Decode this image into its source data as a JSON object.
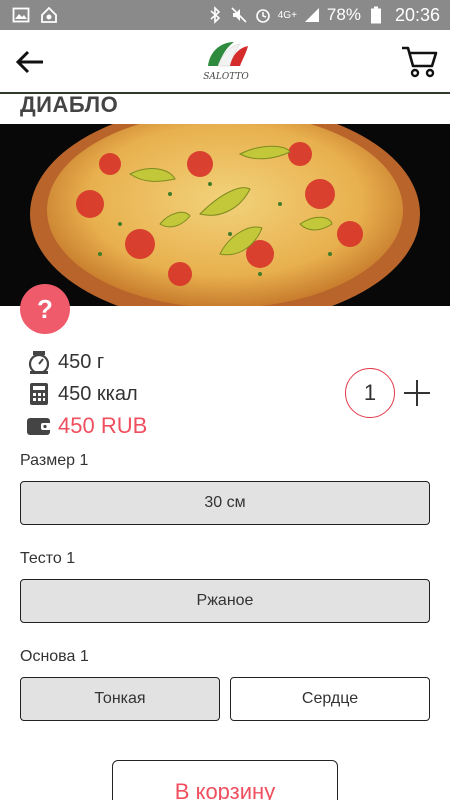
{
  "status_bar": {
    "network": "4G+",
    "battery": "78%",
    "time": "20:36"
  },
  "app": {
    "logo_text": "SALOTTO"
  },
  "product": {
    "title": "ДИАБЛО",
    "help_label": "?",
    "weight": "450 г",
    "calories": "450 ккал",
    "price": "450 RUB",
    "quantity": "1"
  },
  "options": {
    "size": {
      "label": "Размер 1",
      "choices": [
        "30 см"
      ]
    },
    "dough": {
      "label": "Тесто 1",
      "choices": [
        "Ржаное"
      ]
    },
    "base": {
      "label": "Основа 1",
      "choices": [
        "Тонкая",
        "Сердце"
      ]
    }
  },
  "actions": {
    "add_to_cart": "В корзину"
  },
  "colors": {
    "accent": "#ef4f5f",
    "status_bar": "#8a8a8a",
    "selected_option": "#e2e2e2"
  },
  "icons": [
    "image-icon",
    "home-icon",
    "bluetooth-icon",
    "mute-icon",
    "alarm-icon",
    "signal-icon",
    "battery-icon",
    "back-arrow-icon",
    "cart-icon",
    "scale-icon",
    "calculator-icon",
    "wallet-icon",
    "plus-icon"
  ]
}
